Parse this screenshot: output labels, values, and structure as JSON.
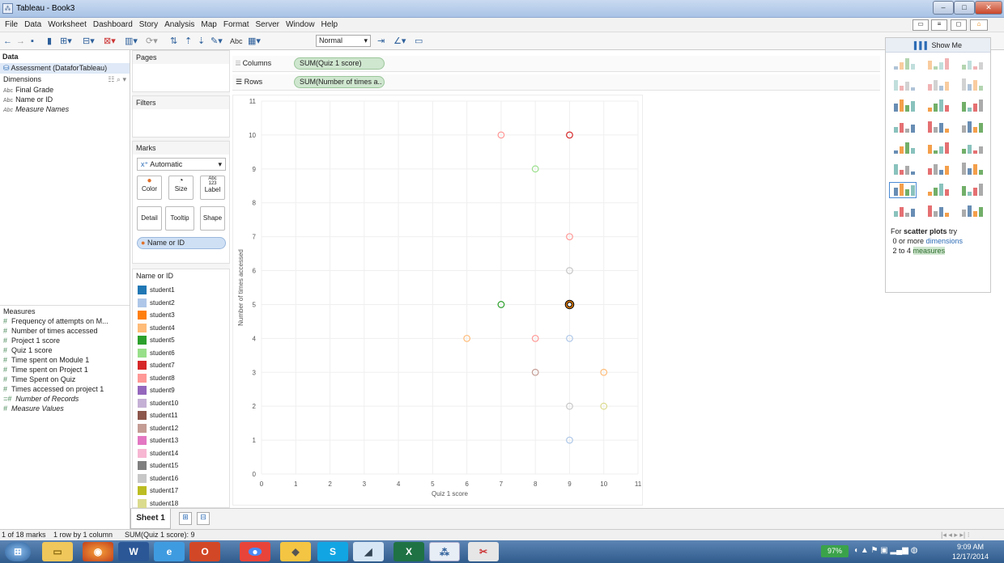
{
  "window": {
    "title": "Tableau - Book3",
    "icon": "tableau-app-icon"
  },
  "menu": [
    "File",
    "Data",
    "Worksheet",
    "Dashboard",
    "Story",
    "Analysis",
    "Map",
    "Format",
    "Server",
    "Window",
    "Help"
  ],
  "toolbar": {
    "fit_value": "Normal",
    "abc_label": "Abc"
  },
  "data_pane": {
    "header": "Data",
    "datasource": "Assessment (DataforTableau)",
    "dimensions_header": "Dimensions",
    "dimensions": [
      {
        "type": "Abc",
        "name": "Final Grade",
        "italic": false
      },
      {
        "type": "Abc",
        "name": "Name or ID",
        "italic": false
      },
      {
        "type": "Abc",
        "name": "Measure Names",
        "italic": true
      }
    ],
    "measures_header": "Measures",
    "measures": [
      {
        "type": "#",
        "name": "Frequency of attempts on M...",
        "italic": false
      },
      {
        "type": "#",
        "name": "Number of times accessed",
        "italic": false
      },
      {
        "type": "#",
        "name": "Project 1 score",
        "italic": false
      },
      {
        "type": "#",
        "name": "Quiz 1 score",
        "italic": false
      },
      {
        "type": "#",
        "name": "Time spent on Module 1",
        "italic": false
      },
      {
        "type": "#",
        "name": "Time spent on Project 1",
        "italic": false
      },
      {
        "type": "#",
        "name": "Time Spent on Quiz",
        "italic": false
      },
      {
        "type": "#",
        "name": "Times accessed on project 1",
        "italic": false
      },
      {
        "type": "=#",
        "name": "Number of Records",
        "italic": true
      },
      {
        "type": "#",
        "name": "Measure Values",
        "italic": true
      }
    ]
  },
  "pages": {
    "label": "Pages"
  },
  "filters": {
    "label": "Filters"
  },
  "marks": {
    "label": "Marks",
    "mark_type": "Automatic",
    "buttons": {
      "color": "Color",
      "size": "Size",
      "label": "Label",
      "detail": "Detail",
      "tooltip": "Tooltip",
      "shape": "Shape",
      "label_glyph": "Abc\n123"
    },
    "color_pill": "Name or ID"
  },
  "shelves": {
    "columns_label": "Columns",
    "columns_pill": "SUM(Quiz 1 score)",
    "rows_label": "Rows",
    "rows_pill": "SUM(Number of times a.."
  },
  "legend": {
    "title": "Name or ID",
    "items": [
      {
        "name": "student1",
        "color": "#1f77b4"
      },
      {
        "name": "student2",
        "color": "#aec7e8"
      },
      {
        "name": "student3",
        "color": "#ff7f0e"
      },
      {
        "name": "student4",
        "color": "#ffbb78"
      },
      {
        "name": "student5",
        "color": "#2ca02c"
      },
      {
        "name": "student6",
        "color": "#98df8a"
      },
      {
        "name": "student7",
        "color": "#d62728"
      },
      {
        "name": "student8",
        "color": "#ff9896"
      },
      {
        "name": "student9",
        "color": "#9467bd"
      },
      {
        "name": "student10",
        "color": "#c5b0d5"
      },
      {
        "name": "student11",
        "color": "#8c564b"
      },
      {
        "name": "student12",
        "color": "#c49c94"
      },
      {
        "name": "student13",
        "color": "#e377c2"
      },
      {
        "name": "student14",
        "color": "#f7b6d2"
      },
      {
        "name": "student15",
        "color": "#7f7f7f"
      },
      {
        "name": "student16",
        "color": "#c7c7c7"
      },
      {
        "name": "student17",
        "color": "#bcbd22"
      },
      {
        "name": "student18",
        "color": "#dbdb8d"
      }
    ]
  },
  "chart_data": {
    "type": "scatter",
    "xlabel": "Quiz 1 score",
    "ylabel": "Number of times accessed",
    "xlim": [
      0,
      11
    ],
    "ylim": [
      0,
      11
    ],
    "x_ticks": [
      0,
      1,
      2,
      3,
      4,
      5,
      6,
      7,
      8,
      9,
      10,
      11
    ],
    "y_ticks": [
      0,
      1,
      2,
      3,
      4,
      5,
      6,
      7,
      8,
      9,
      10,
      11
    ],
    "grid": true,
    "points": [
      {
        "x": 7,
        "y": 10,
        "color": "#ff9896"
      },
      {
        "x": 9,
        "y": 10,
        "color": "#d62728"
      },
      {
        "x": 8,
        "y": 9,
        "color": "#98df8a"
      },
      {
        "x": 9,
        "y": 7,
        "color": "#ff9896"
      },
      {
        "x": 9,
        "y": 6,
        "color": "#c7c7c7"
      },
      {
        "x": 7,
        "y": 5,
        "color": "#2ca02c"
      },
      {
        "x": 9,
        "y": 5,
        "color": "#8c564b",
        "selected": true
      },
      {
        "x": 6,
        "y": 4,
        "color": "#ffbb78"
      },
      {
        "x": 8,
        "y": 4,
        "color": "#ff9896"
      },
      {
        "x": 9,
        "y": 4,
        "color": "#aec7e8"
      },
      {
        "x": 8,
        "y": 3,
        "color": "#c49c94"
      },
      {
        "x": 10,
        "y": 3,
        "color": "#ffbb78"
      },
      {
        "x": 9,
        "y": 2,
        "color": "#c7c7c7"
      },
      {
        "x": 10,
        "y": 2,
        "color": "#dbdb8d"
      },
      {
        "x": 9,
        "y": 1,
        "color": "#aec7e8"
      }
    ]
  },
  "show_me": {
    "title": "Show Me",
    "hint_prefix": "For ",
    "hint_bold": "scatter plots",
    "hint_suffix": " try",
    "req1_prefix": "0 or more ",
    "req1_link": "dimensions",
    "req2_prefix": "2 to 4 ",
    "req2_link": "measures"
  },
  "sheet_tab": "Sheet 1",
  "status": {
    "marks": "1 of 18 marks",
    "layout": "1 row by 1 column",
    "sum": "SUM(Quiz 1 score): 9"
  },
  "taskbar": {
    "battery": "97%",
    "time": "9:09 AM",
    "date": "12/17/2014"
  }
}
